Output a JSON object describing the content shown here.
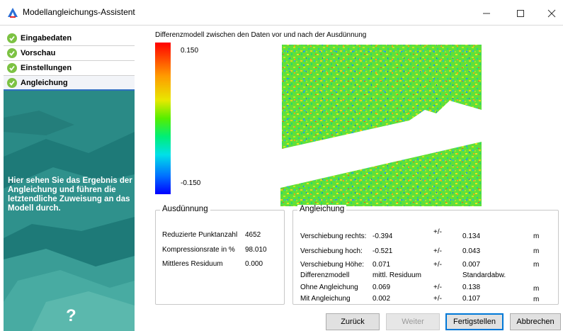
{
  "window": {
    "title": "Modellangleichungs-Assistent"
  },
  "steps": [
    {
      "label": "Eingabedaten"
    },
    {
      "label": "Vorschau"
    },
    {
      "label": "Einstellungen"
    },
    {
      "label": "Angleichung"
    }
  ],
  "sidebar": {
    "info_text": "Hier sehen Sie das Ergebnis der Angleichung und führen die letztendliche Zuweisung an das Modell durch.",
    "help_label": "?"
  },
  "preview": {
    "caption": "Differenzmodell zwischen den Daten vor und nach der Ausdünnung",
    "scale_max": "0.150",
    "scale_min": "-0.150"
  },
  "ausduennung": {
    "title": "Ausdünnung",
    "rows": [
      {
        "label": "Reduzierte Punktanzahl",
        "value": "4652"
      },
      {
        "label": "Kompressionsrate in %",
        "value": "98.010"
      },
      {
        "label": "Mittleres Residuum",
        "value": "0.000"
      }
    ]
  },
  "angleichung": {
    "title": "Angleichung",
    "rows": [
      {
        "label": "Verschiebung rechts:",
        "value": "-0.394",
        "pm": "+/-",
        "dev": "0.134",
        "unit": "m"
      },
      {
        "label": "Verschiebung hoch:",
        "value": "-0.521",
        "pm": "+/-",
        "dev": "0.043",
        "unit": "m"
      },
      {
        "label": "Verschiebung Höhe:",
        "value": "0.071",
        "pm": "+/-",
        "dev": "0.007",
        "unit": "m"
      }
    ],
    "header": {
      "label": "Differenzmodell",
      "col1": "mittl. Residuum",
      "col2": "Standardabw."
    },
    "residual_rows": [
      {
        "label": "Ohne Angleichung",
        "value": "0.069",
        "pm": "+/-",
        "dev": "0.138",
        "unit": "m"
      },
      {
        "label": "Mit Angleichung",
        "value": "0.002",
        "pm": "+/-",
        "dev": "0.107",
        "unit": "m"
      }
    ]
  },
  "buttons": {
    "back": "Zurück",
    "next": "Weiter",
    "finish": "Fertigstellen",
    "cancel": "Abbrechen"
  },
  "icons": {
    "app": "app-logo-icon",
    "step_done": "check-circle-icon",
    "minimize": "minimize-icon",
    "maximize": "maximize-icon",
    "close": "close-icon"
  },
  "colors": {
    "sidebar_bg": "#1e7a78",
    "step_check": "#7cc243",
    "active_step_border": "#2f6fc0",
    "primary_button_border": "#0078d7"
  }
}
